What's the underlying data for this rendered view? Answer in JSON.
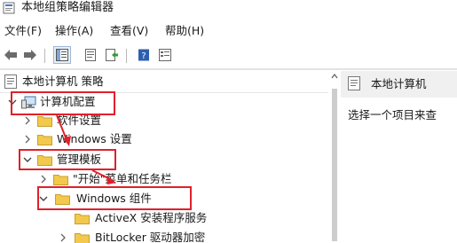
{
  "window": {
    "title": "本地组策略编辑器"
  },
  "menu": [
    {
      "label": "文件(F)"
    },
    {
      "label": "操作(A)"
    },
    {
      "label": "查看(V)"
    },
    {
      "label": "帮助(H)"
    }
  ],
  "toolbar": {
    "buttons": [
      "back-arrow-icon",
      "forward-arrow-icon",
      "show-hide-tree-icon",
      "properties-sheet-icon",
      "export-list-icon",
      "help-icon",
      "filter-view-icon"
    ]
  },
  "tree": {
    "root_label": "本地计算机 策略",
    "nodes": [
      {
        "label": "计算机配置",
        "expanded": true,
        "highlighted": true
      },
      {
        "label": "软件设置",
        "expanded": false
      },
      {
        "label": "Windows 设置",
        "expanded": false
      },
      {
        "label": "管理模板",
        "expanded": true,
        "highlighted": true
      },
      {
        "label": "\"开始\"菜单和任务栏",
        "expanded": false
      },
      {
        "label": "Windows 组件",
        "expanded": true,
        "highlighted": true
      },
      {
        "label": "ActiveX 安装程序服务",
        "expanded": false
      },
      {
        "label": "BitLocker 驱动器加密",
        "expanded": false
      }
    ]
  },
  "right_pane": {
    "header": "本地计算机",
    "body": "选择一个项目来查"
  },
  "colors": {
    "annotation_red": "#e0202a",
    "folder_yellow": "#f2c94c"
  }
}
